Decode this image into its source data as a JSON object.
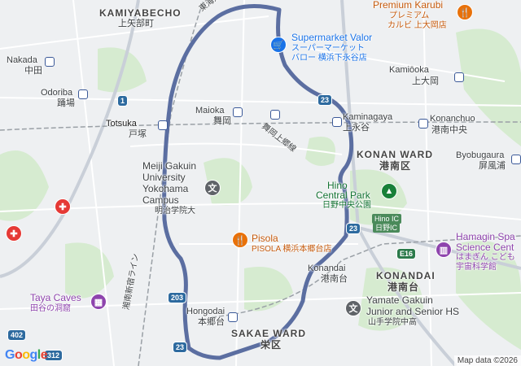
{
  "map": {
    "attribution": "Map data ©2026",
    "logo": "Google",
    "route_color": "#5b6ea1"
  },
  "places": {
    "kamiyabecho": {
      "en": "KAMIYABECHO",
      "ja": "上矢部町"
    },
    "nakada": {
      "en": "Nakada",
      "ja": "中田"
    },
    "odoriba": {
      "en": "Odoriba",
      "ja": "踊場"
    },
    "totsuka": {
      "en": "Totsuka",
      "ja": "戸塚"
    },
    "maioka": {
      "en": "Maioka",
      "ja": "舞岡"
    },
    "maioka_road": "舞岡上郷線",
    "kaminagaya": {
      "en": "Kaminagaya",
      "ja": "上永谷"
    },
    "konan_ward": {
      "en": "KONAN WARD",
      "ja": "港南区"
    },
    "kamiooka": {
      "en": "Kamiōoka",
      "ja": "上大岡"
    },
    "konanchuo": {
      "en": "Konanchuo",
      "ja": "港南中央"
    },
    "byobugaura": {
      "en": "Byobugaura",
      "ja": "屏風浦"
    },
    "university": {
      "l1": "Meiji Gakuin",
      "l2": "University",
      "l3": "Yokohama",
      "l4": "Campus",
      "ja": "明治学院大"
    },
    "hino_park": {
      "l1": "Hino",
      "l2": "Central Park",
      "ja": "日野中央公園"
    },
    "hino_ic": {
      "en": "Hino IC",
      "ja": "日野IC"
    },
    "pisola": {
      "en": "Pisola",
      "ja": "PISOLA 横浜本郷台店"
    },
    "konandai": {
      "en": "Konandai",
      "ja": "港南台"
    },
    "konandai_area": {
      "en": "KONANDAI",
      "ja": "港南台"
    },
    "hamagin": {
      "l1": "Hamagin Spa",
      "l2": "Science Cent",
      "l3": "はまぎん こども",
      "l4": "宇宙科学館"
    },
    "taya_caves": {
      "en": "Taya Caves",
      "ja": "田谷の洞窟"
    },
    "hongodai": {
      "en": "Hongodai",
      "ja": "本郷台"
    },
    "sakae_ward": {
      "en": "SAKAE WARD",
      "ja": "栄区"
    },
    "yamate": {
      "l1": "Yamate Gakuin",
      "l2": "Junior and Senior HS",
      "ja": "山手学院中高"
    },
    "supermarket": {
      "en": "Supermarket Valor",
      "ja1": "スーパーマーケット",
      "ja2": "バロー 横浜下永谷店"
    },
    "premium": {
      "en": "Premium Karubi",
      "ja1": "プレミアム",
      "ja2": "カルビ 上大岡店"
    },
    "tokaido_road": "東海道本線",
    "shonan_line": "湘南新宿ライン"
  },
  "shields": {
    "r1": "1",
    "r23a": "23",
    "r23b": "23",
    "r23c": "23",
    "r203": "203",
    "r402": "402",
    "r312": "312",
    "e16": "E16"
  },
  "colors": {
    "route": "#5b6ea1",
    "park": "#cfe8c8",
    "water": "#aad3df",
    "road_major": "#ffffff",
    "highway": "#c7cbd2",
    "red_pin": "#e53935",
    "purple_pin": "#8e44ad",
    "orange_pin": "#e8710a",
    "blue_pin": "#1a73e8",
    "green_park_pin": "#188038"
  }
}
